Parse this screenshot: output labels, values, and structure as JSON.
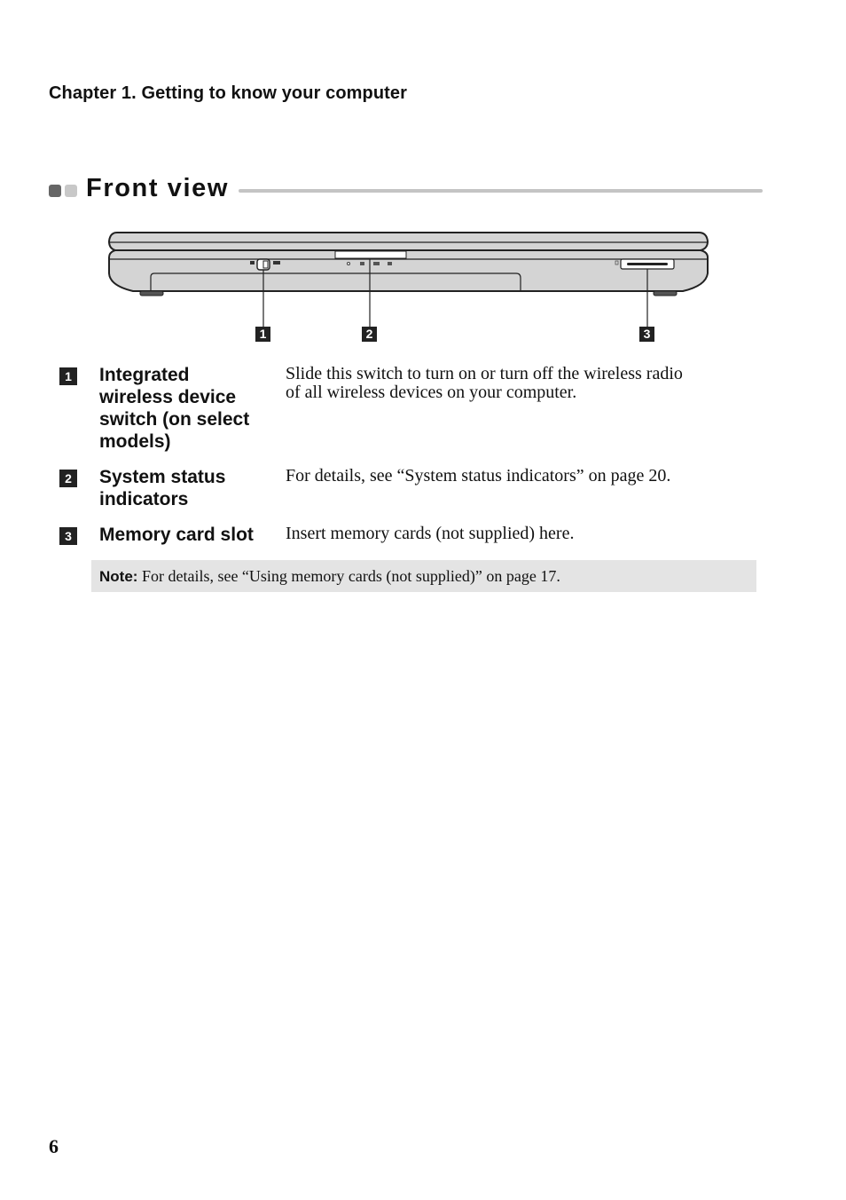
{
  "header": {
    "chapter_title": "Chapter 1. Getting to know your computer"
  },
  "section": {
    "title": "Front view"
  },
  "figure": {
    "description": "Laptop front view illustration",
    "callouts": [
      "1",
      "2",
      "3"
    ]
  },
  "items": [
    {
      "number": "1",
      "term": "Integrated wireless device switch  (on select models)",
      "term_lines": [
        "Integrated",
        "wireless device",
        "switch  (on select",
        "models)"
      ],
      "description_lines": [
        "Slide this switch to turn on or turn off the wireless radio",
        "of all wireless devices on your computer."
      ]
    },
    {
      "number": "2",
      "term": "System status indicators",
      "term_lines": [
        "System status",
        "indicators"
      ],
      "description_lines": [
        "For details, see “System status indicators” on page 20."
      ]
    },
    {
      "number": "3",
      "term": "Memory card slot",
      "term_lines": [
        "Memory card slot"
      ],
      "description_lines": [
        "Insert memory cards (not supplied) here."
      ]
    }
  ],
  "note": {
    "label": "Note:",
    "text": " For details, see “Using memory cards (not supplied)” on page 17."
  },
  "footer": {
    "page_number": "6"
  },
  "colors": {
    "laptop_body": "#d4d4d4",
    "callout_bg": "#222222",
    "note_bg": "#e4e4e4",
    "rule": "#c4c4c4"
  }
}
